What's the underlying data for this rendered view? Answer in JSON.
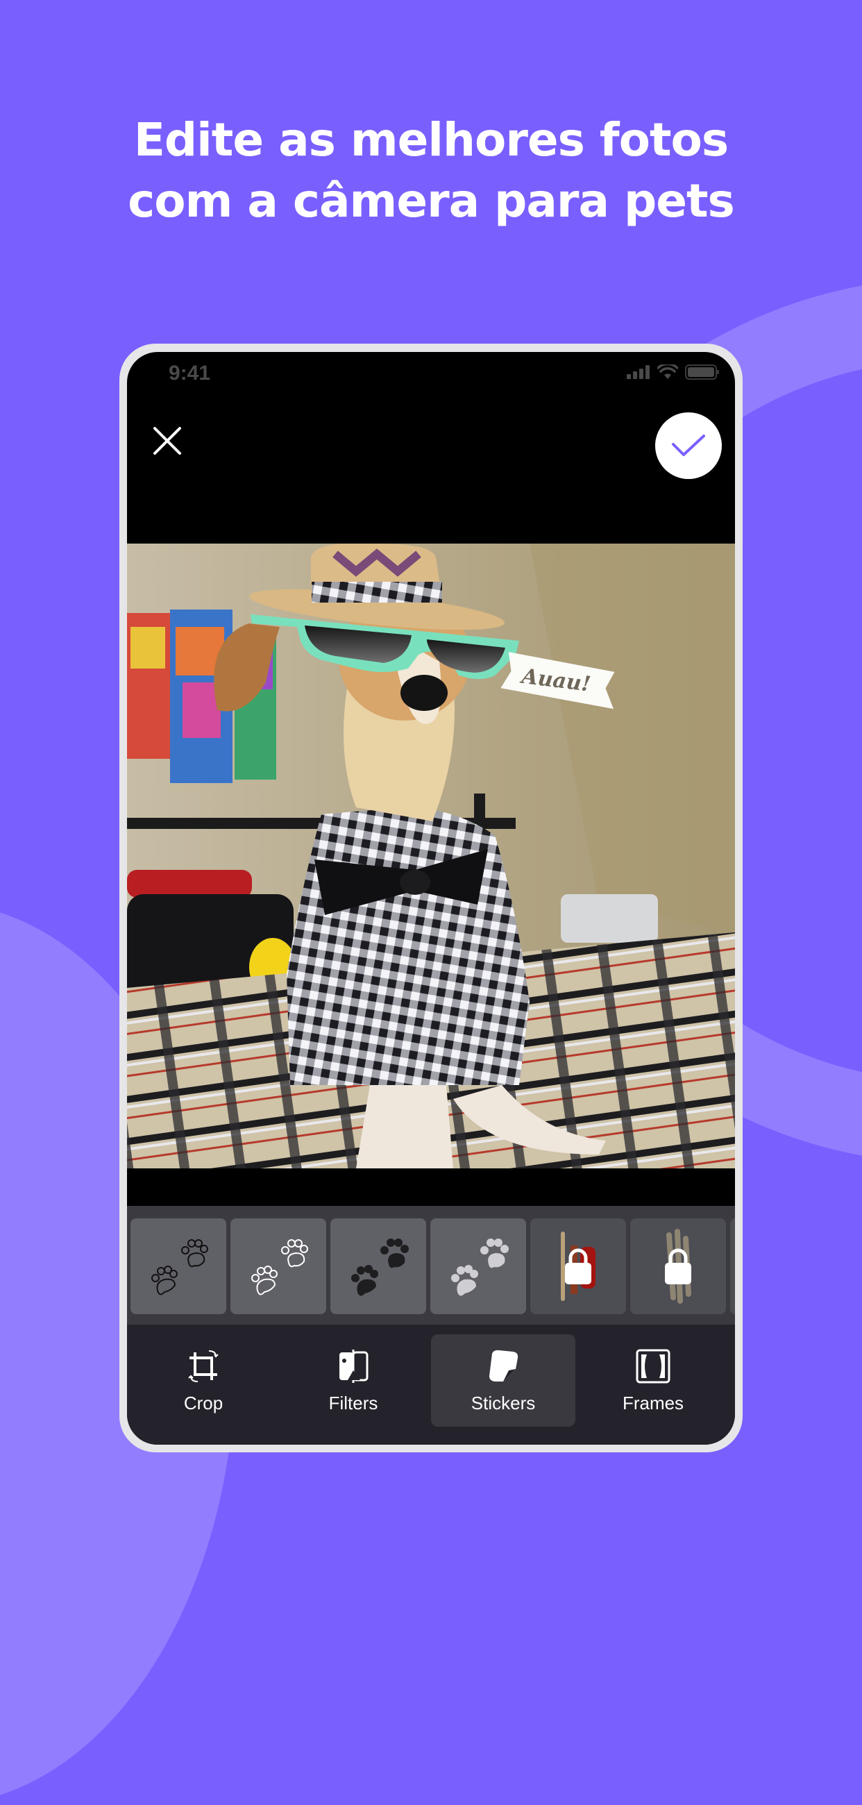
{
  "headline": {
    "line1": "Edite as melhores fotos",
    "line2": "com a câmera para pets"
  },
  "colors": {
    "background": "#7a5fff",
    "background_shape": "#937dff",
    "accent": "#7a5fff",
    "sunglasses_frame": "#79e0bd"
  },
  "status_bar": {
    "time": "9:41",
    "icons": [
      "signal-icon",
      "wifi-icon",
      "battery-icon"
    ]
  },
  "editor": {
    "close_icon": "close-icon",
    "confirm_icon": "checkmark-icon",
    "photo_stickers": {
      "speech_banner_text": "Auau!",
      "applied": [
        "sunglasses",
        "speech-banner"
      ]
    }
  },
  "sticker_tray": {
    "items": [
      {
        "name": "paw-prints-outline-black",
        "locked": false
      },
      {
        "name": "paw-prints-outline-white",
        "locked": false
      },
      {
        "name": "paw-prints-solid-black",
        "locked": false
      },
      {
        "name": "paw-prints-solid-grey",
        "locked": false
      },
      {
        "name": "treats-sticker",
        "locked": true
      },
      {
        "name": "sticks-sticker",
        "locked": true
      }
    ]
  },
  "bottom_nav": {
    "tabs": [
      {
        "label": "Crop",
        "icon": "crop-icon",
        "active": false
      },
      {
        "label": "Filters",
        "icon": "filters-icon",
        "active": false
      },
      {
        "label": "Stickers",
        "icon": "sticker-icon",
        "active": true
      },
      {
        "label": "Frames",
        "icon": "frame-icon",
        "active": false
      }
    ]
  }
}
